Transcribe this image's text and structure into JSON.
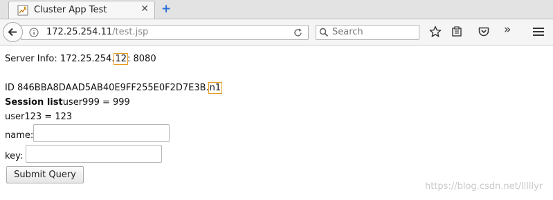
{
  "browser": {
    "tab": {
      "title": "Cluster App Test",
      "close_glyph": "✕",
      "favicon": "page-favicon-icon"
    },
    "new_tab_glyph": "+",
    "url": {
      "host": "172.25.254.11",
      "path": "/test.jsp"
    },
    "search": {
      "placeholder": "Search"
    },
    "toolbar_icons": [
      "bookmark-star-icon",
      "reading-list-icon",
      "pocket-icon",
      "overflow-chevron-icon",
      "hamburger-menu-icon"
    ],
    "overflow_glyph": "»"
  },
  "page": {
    "server_info": {
      "prefix": "Server Info: 172.25.254.",
      "node": "12",
      "suffix": ": 8080"
    },
    "session_id": {
      "prefix": "ID 846BBA8DAAD5AB40E9FF255E0F2D7E3B.",
      "route": "n1"
    },
    "session_list": {
      "label": "Session list",
      "first_entry": "user999 = 999"
    },
    "second_entry": "user123 = 123",
    "form": {
      "name_label": "name:",
      "name_value": "",
      "key_label": "key:",
      "key_value": "",
      "submit_label": "Submit Query"
    },
    "watermark": "https://blog.csdn.net/lllllyr"
  },
  "colors": {
    "highlight_outline": "#e59a1a",
    "newtab_blue": "#2a6fd6"
  }
}
